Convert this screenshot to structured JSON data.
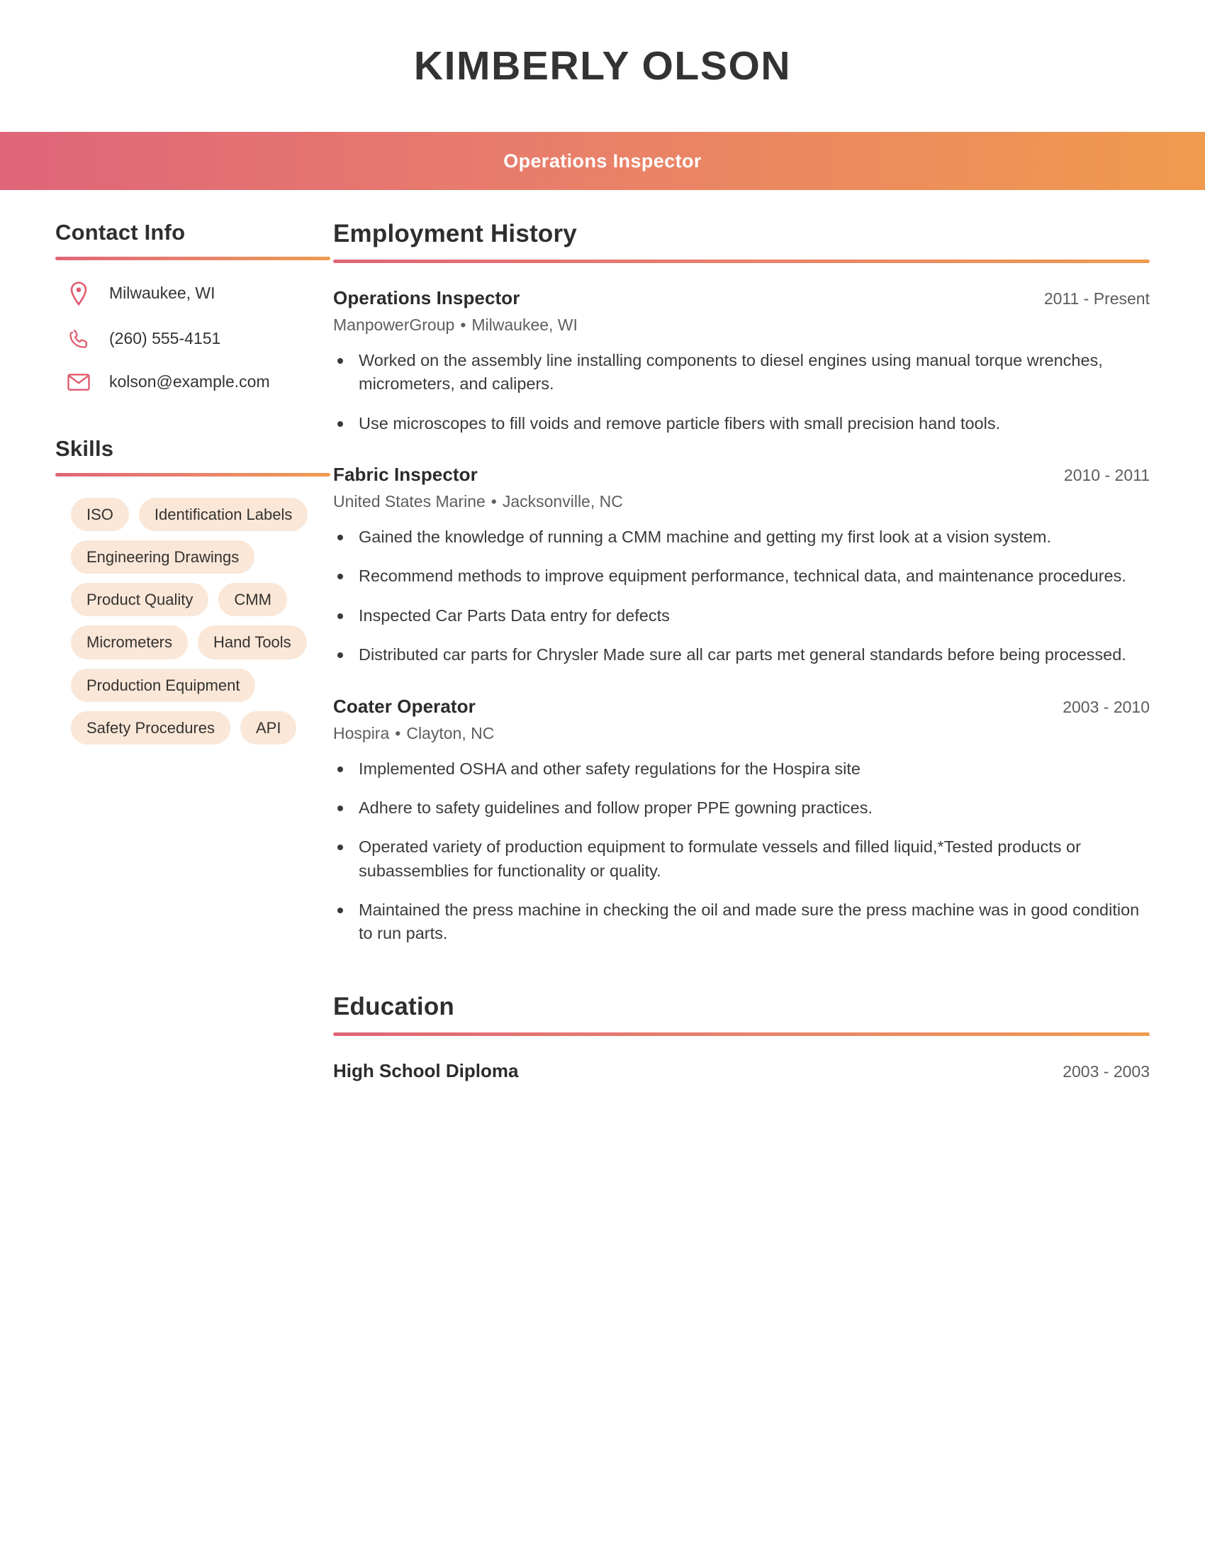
{
  "header": {
    "name": "KIMBERLY OLSON",
    "job_title_band": "Operations Inspector",
    "accent_start": "#e06579",
    "accent_end": "#ef9b4e"
  },
  "sidebar": {
    "contact": {
      "heading": "Contact Info",
      "items": [
        {
          "icon": "location-pin-icon",
          "value": "Milwaukee, WI"
        },
        {
          "icon": "phone-icon",
          "value": "(260) 555-4151"
        },
        {
          "icon": "envelope-icon",
          "value": "kolson@example.com"
        }
      ]
    },
    "skills": {
      "heading": "Skills",
      "items": [
        "ISO",
        "Identification Labels",
        "Engineering Drawings",
        "Product Quality",
        "CMM",
        "Micrometers",
        "Hand Tools",
        "Production Equipment",
        "Safety Procedures",
        "API"
      ]
    }
  },
  "main": {
    "employment": {
      "heading": "Employment History",
      "jobs": [
        {
          "title": "Operations Inspector",
          "dates": "2011 - Present",
          "company": "ManpowerGroup",
          "location": "Milwaukee, WI",
          "bullets": [
            "Worked on the assembly line installing components to diesel engines using manual torque wrenches, micrometers, and calipers.",
            "Use microscopes to fill voids and remove particle fibers with small precision hand tools."
          ]
        },
        {
          "title": "Fabric Inspector",
          "dates": "2010 - 2011",
          "company": "United States Marine",
          "location": "Jacksonville, NC",
          "bullets": [
            "Gained the knowledge of running a CMM machine and getting my first look at a vision system.",
            "Recommend methods to improve equipment performance, technical data, and maintenance procedures.",
            "Inspected Car Parts Data entry for defects",
            "Distributed car parts for Chrysler Made sure all car parts met general standards before being processed."
          ]
        },
        {
          "title": "Coater Operator",
          "dates": "2003 - 2010",
          "company": "Hospira",
          "location": "Clayton, NC",
          "bullets": [
            "Implemented OSHA and other safety regulations for the Hospira site",
            "Adhere to safety guidelines and follow proper PPE gowning practices.",
            "Operated variety of production equipment to formulate vessels and filled liquid,*Tested products or subassemblies for functionality or quality.",
            "Maintained the press machine in checking the oil and made sure the press machine was in good condition to run parts."
          ]
        }
      ]
    },
    "education": {
      "heading": "Education",
      "entries": [
        {
          "degree": "High School Diploma",
          "dates": "2003 - 2003"
        }
      ]
    }
  },
  "separator_bullet": "•"
}
